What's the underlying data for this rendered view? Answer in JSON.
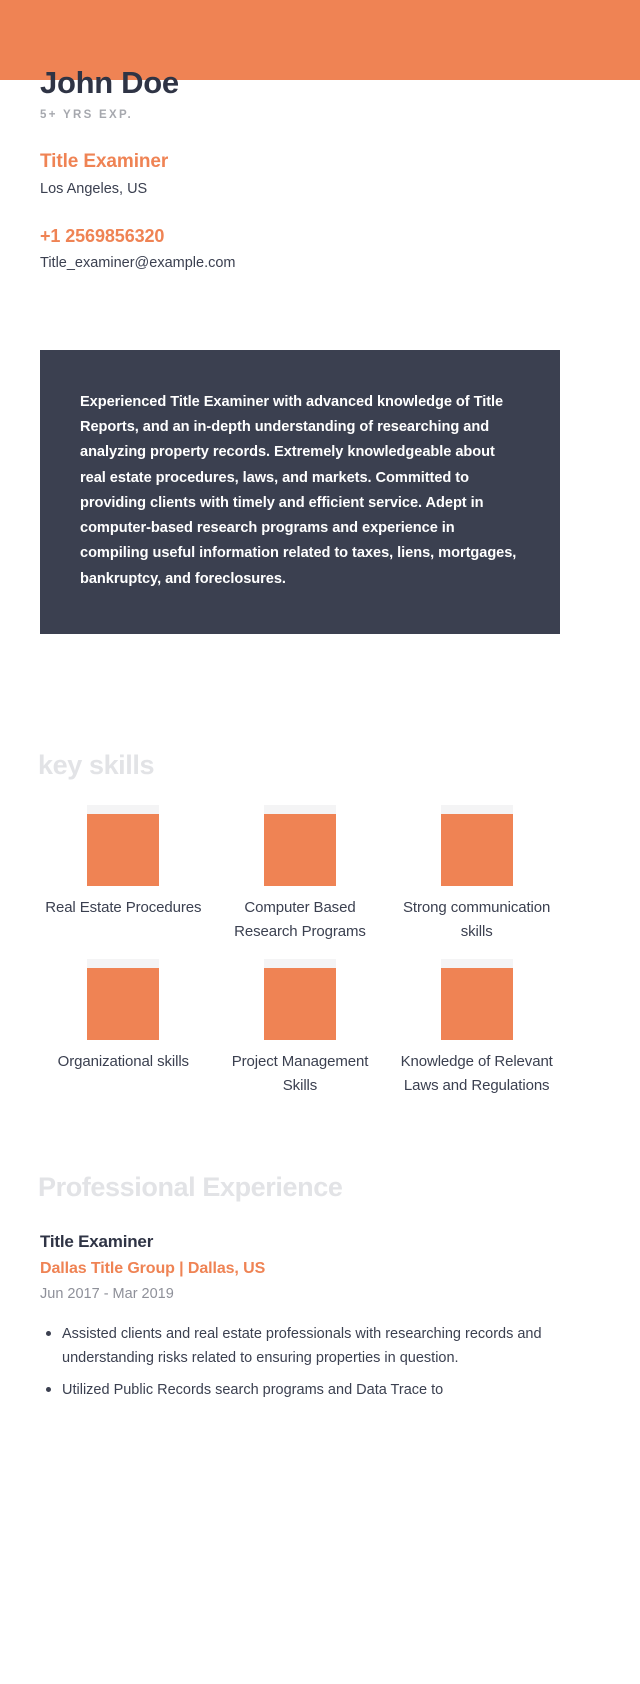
{
  "theme": {
    "accent": "#ef8354",
    "accent_light": "#fceae2",
    "dark": "#3b4050",
    "heading_ghost": "#e2e3e6",
    "muted": "#8e9099",
    "skill_cap": "#f4f4f5"
  },
  "header": {
    "name": "John Doe",
    "experience_badge": "5+ YRS EXP.",
    "role": "Title Examiner",
    "location": "Los Angeles, US",
    "phone": "+1 2569856320",
    "email": "Title_examiner@example.com"
  },
  "summary": {
    "text": "Experienced Title Examiner with advanced knowledge of Title Reports, and an in-depth understanding of researching and analyzing property records. Extremely knowledgeable about real estate procedures, laws, and markets. Committed to providing clients with timely and efficient service. Adept in computer-based research programs and experience in compiling useful information related to taxes, liens, mortgages, bankruptcy, and foreclosures."
  },
  "skills_section": {
    "heading": "key skills",
    "items": [
      {
        "label": "Real Estate Procedures"
      },
      {
        "label": "Computer Based Research Programs"
      },
      {
        "label": "Strong communication skills"
      },
      {
        "label": "Organizational skills"
      },
      {
        "label": "Project Management Skills"
      },
      {
        "label": "Knowledge of Relevant Laws and Regulations"
      }
    ]
  },
  "experience_section": {
    "heading": "Professional Experience",
    "jobs": [
      {
        "title": "Title Examiner",
        "company": "Dallas Title Group | Dallas, US",
        "dates": "Jun 2017 - Mar 2019",
        "bullets": [
          "Assisted clients and real estate professionals with researching records and understanding risks related to ensuring properties in question.",
          "Utilized Public Records search programs and Data Trace to"
        ]
      }
    ]
  }
}
